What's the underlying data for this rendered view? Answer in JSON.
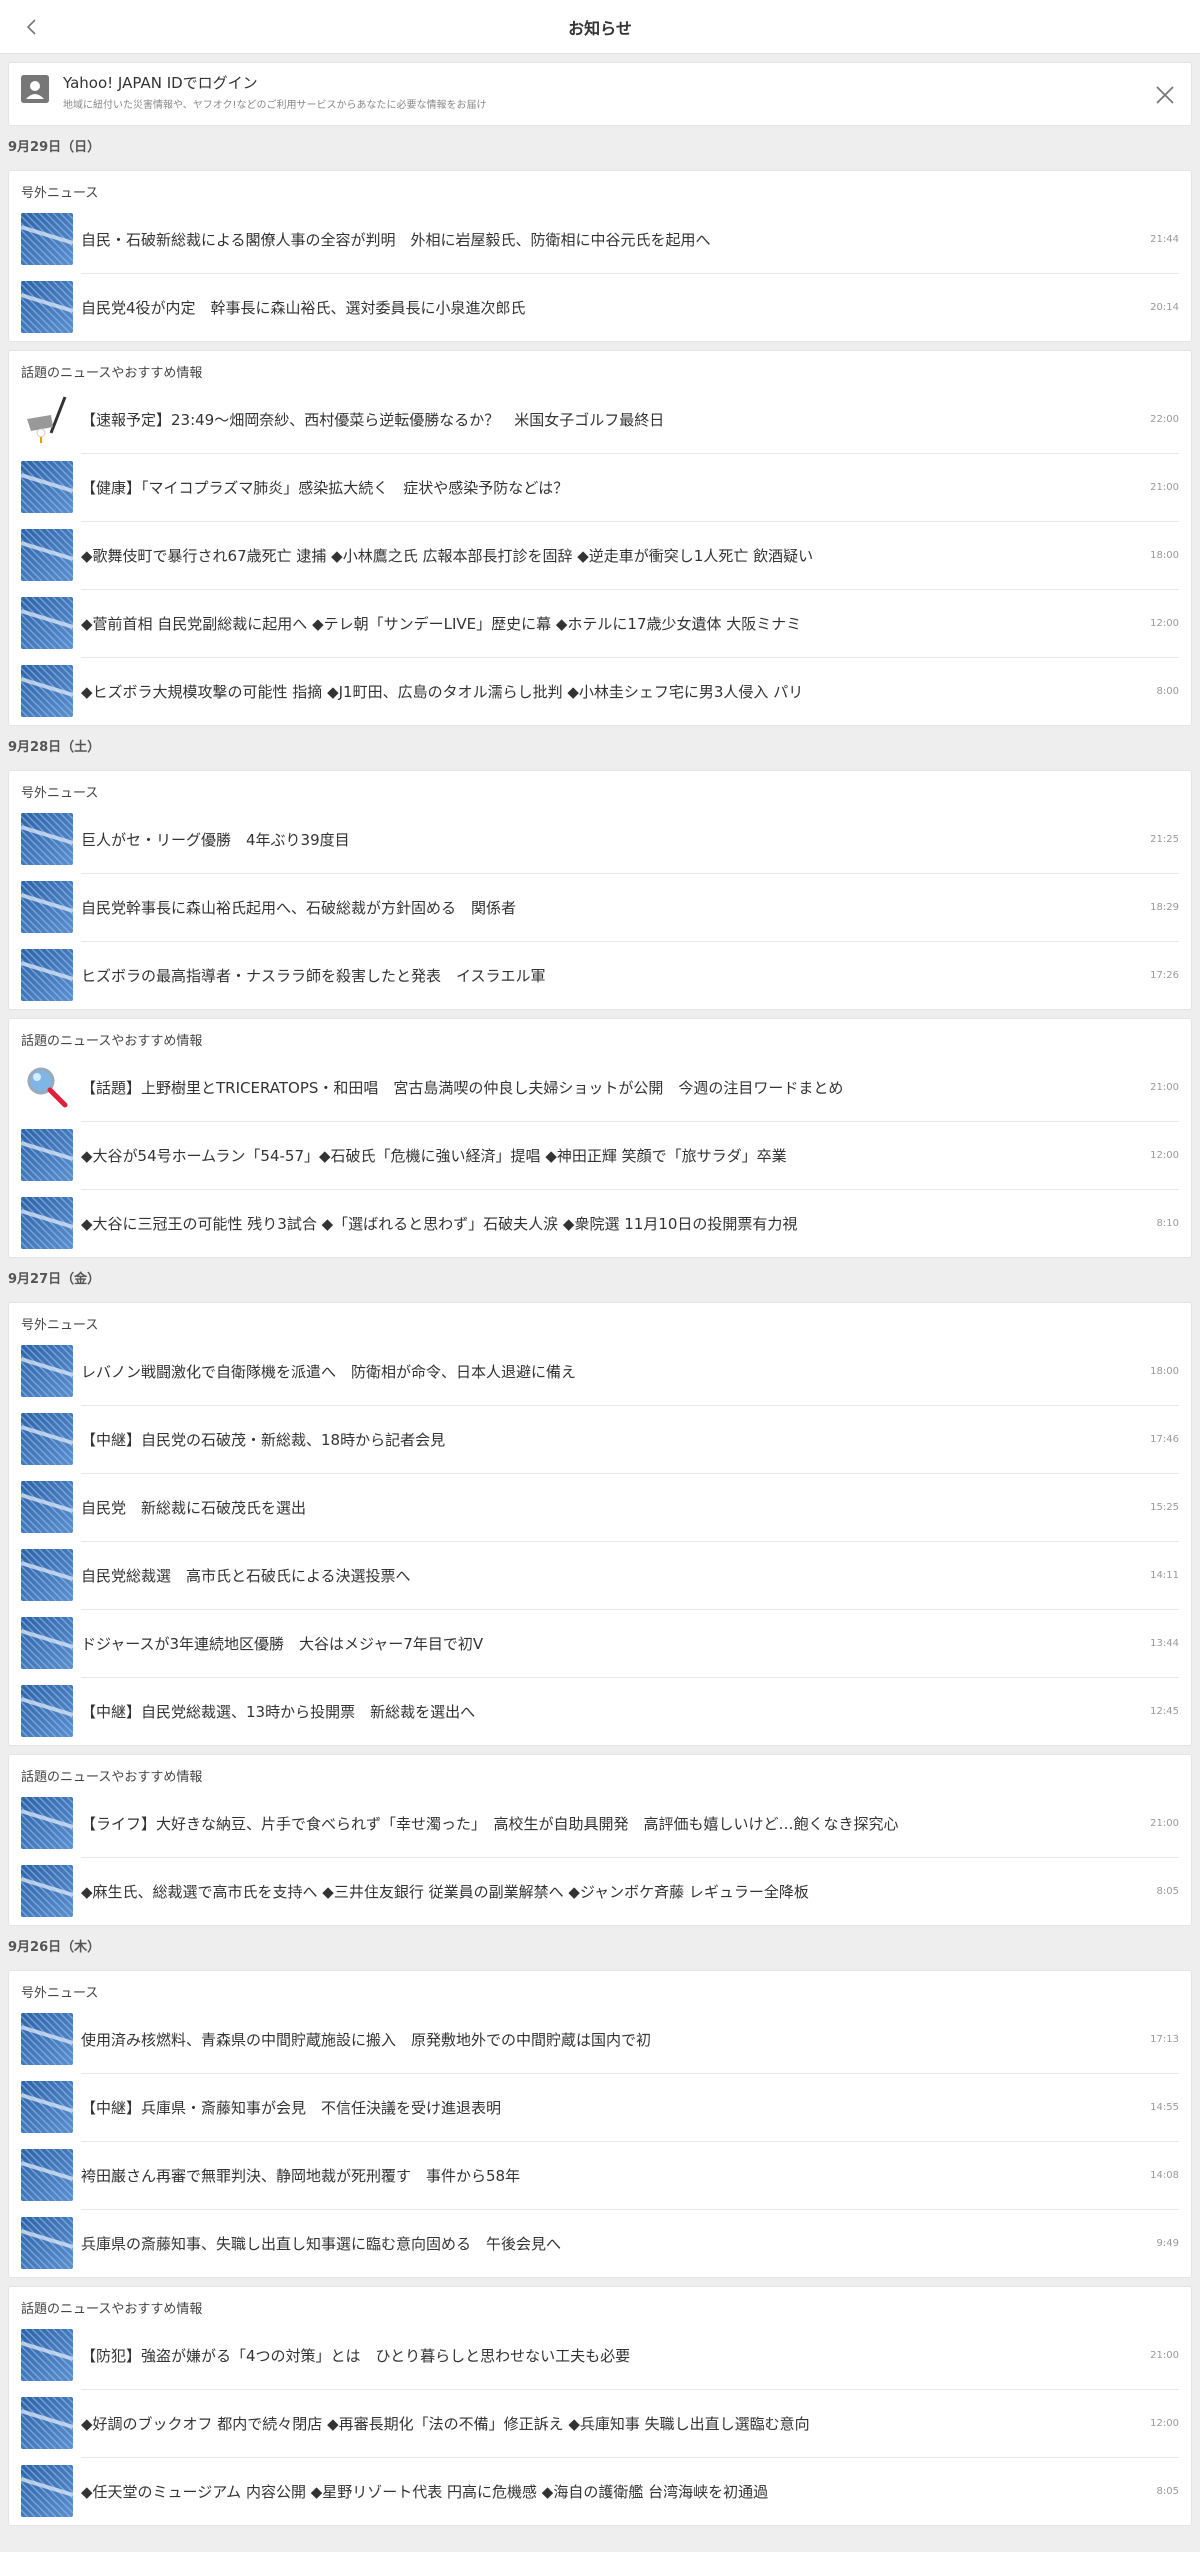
{
  "header": {
    "title": "お知らせ",
    "back_icon": "chevron-left-icon"
  },
  "login_banner": {
    "title": "Yahoo! JAPAN IDでログイン",
    "subtitle": "地域に紐付いた災害情報や、ヤフオク!などのご利用サービスからあなたに必要な情報をお届け",
    "avatar_icon": "user-icon",
    "close_icon": "close-icon"
  },
  "colors": {
    "thumb_blue": "#3a6fb0",
    "background": "#eeeeee",
    "card": "#ffffff"
  },
  "days": [
    {
      "date": "9月29日（日）",
      "sections": [
        {
          "label": "号外ニュース",
          "items": [
            {
              "title": "自民・石破新総裁による閣僚人事の全容が判明　外相に岩屋毅氏、防衛相に中谷元氏を起用へ",
              "time": "21:44",
              "thumb": "blue"
            },
            {
              "title": "自民党4役が内定　幹事長に森山裕氏、選対委員長に小泉進次郎氏",
              "time": "20:14",
              "thumb": "blue"
            }
          ]
        },
        {
          "label": "話題のニュースやおすすめ情報",
          "items": [
            {
              "title": "【速報予定】23:49～畑岡奈紗、西村優菜ら逆転優勝なるか？　米国女子ゴルフ最終日",
              "time": "22:00",
              "thumb": "golf"
            },
            {
              "title": "【健康】「マイコプラズマ肺炎」感染拡大続く　症状や感染予防などは？",
              "time": "21:00",
              "thumb": "blue"
            },
            {
              "title": "◆歌舞伎町で暴行され67歳死亡 逮捕 ◆小林鷹之氏 広報本部長打診を固辞 ◆逆走車が衝突し1人死亡 飲酒疑い",
              "time": "18:00",
              "thumb": "blue"
            },
            {
              "title": "◆菅前首相 自民党副総裁に起用へ ◆テレ朝「サンデーLIVE」歴史に幕 ◆ホテルに17歳少女遺体 大阪ミナミ",
              "time": "12:00",
              "thumb": "blue"
            },
            {
              "title": "◆ヒズボラ大規模攻撃の可能性 指摘 ◆J1町田、広島のタオル濡らし批判 ◆小林圭シェフ宅に男3人侵入 パリ",
              "time": "8:00",
              "thumb": "blue"
            }
          ]
        }
      ]
    },
    {
      "date": "9月28日（土）",
      "sections": [
        {
          "label": "号外ニュース",
          "items": [
            {
              "title": "巨人がセ・リーグ優勝　4年ぶり39度目",
              "time": "21:25",
              "thumb": "blue"
            },
            {
              "title": "自民党幹事長に森山裕氏起用へ、石破総裁が方針固める　関係者",
              "time": "18:29",
              "thumb": "blue"
            },
            {
              "title": "ヒズボラの最高指導者・ナスララ師を殺害したと発表　イスラエル軍",
              "time": "17:26",
              "thumb": "blue"
            }
          ]
        },
        {
          "label": "話題のニュースやおすすめ情報",
          "items": [
            {
              "title": "【話題】上野樹里とTRICERATOPS・和田唱　宮古島満喫の仲良し夫婦ショットが公開　今週の注目ワードまとめ",
              "time": "21:00",
              "thumb": "search"
            },
            {
              "title": "◆大谷が54号ホームラン「54-57」◆石破氏「危機に強い経済」提唱 ◆神田正輝 笑顔で「旅サラダ」卒業",
              "time": "12:00",
              "thumb": "blue"
            },
            {
              "title": "◆大谷に三冠王の可能性 残り3試合 ◆「選ばれると思わず」石破夫人涙 ◆衆院選 11月10日の投開票有力視",
              "time": "8:10",
              "thumb": "blue"
            }
          ]
        }
      ]
    },
    {
      "date": "9月27日（金）",
      "sections": [
        {
          "label": "号外ニュース",
          "items": [
            {
              "title": "レバノン戦闘激化で自衛隊機を派遣へ　防衛相が命令、日本人退避に備え",
              "time": "18:00",
              "thumb": "blue"
            },
            {
              "title": "【中継】自民党の石破茂・新総裁、18時から記者会見",
              "time": "17:46",
              "thumb": "blue"
            },
            {
              "title": "自民党　新総裁に石破茂氏を選出",
              "time": "15:25",
              "thumb": "blue"
            },
            {
              "title": "自民党総裁選　高市氏と石破氏による決選投票へ",
              "time": "14:11",
              "thumb": "blue"
            },
            {
              "title": "ドジャースが3年連続地区優勝　大谷はメジャー7年目で初V",
              "time": "13:44",
              "thumb": "blue"
            },
            {
              "title": "【中継】自民党総裁選、13時から投開票　新総裁を選出へ",
              "time": "12:45",
              "thumb": "blue"
            }
          ]
        },
        {
          "label": "話題のニュースやおすすめ情報",
          "items": [
            {
              "title": "【ライフ】大好きな納豆、片手で食べられず「幸せ濁った」　高校生が自助具開発　高評価も嬉しいけど…飽くなき探究心",
              "time": "21:00",
              "thumb": "blue"
            },
            {
              "title": "◆麻生氏、総裁選で高市氏を支持へ ◆三井住友銀行 従業員の副業解禁へ ◆ジャンボケ斉藤 レギュラー全降板",
              "time": "8:05",
              "thumb": "blue"
            }
          ]
        }
      ]
    },
    {
      "date": "9月26日（木）",
      "sections": [
        {
          "label": "号外ニュース",
          "items": [
            {
              "title": "使用済み核燃料、青森県の中間貯蔵施設に搬入　原発敷地外での中間貯蔵は国内で初",
              "time": "17:13",
              "thumb": "blue"
            },
            {
              "title": "【中継】兵庫県・斎藤知事が会見　不信任決議を受け進退表明",
              "time": "14:55",
              "thumb": "blue"
            },
            {
              "title": "袴田巌さん再審で無罪判決、静岡地裁が死刑覆す　事件から58年",
              "time": "14:08",
              "thumb": "blue"
            },
            {
              "title": "兵庫県の斎藤知事、失職し出直し知事選に臨む意向固める　午後会見へ",
              "time": "9:49",
              "thumb": "blue"
            }
          ]
        },
        {
          "label": "話題のニュースやおすすめ情報",
          "items": [
            {
              "title": "【防犯】強盗が嫌がる「4つの対策」とは　ひとり暮らしと思わせない工夫も必要",
              "time": "21:00",
              "thumb": "blue"
            },
            {
              "title": "◆好調のブックオフ 都内で続々閉店 ◆再審長期化「法の不備」修正訴え ◆兵庫知事 失職し出直し選臨む意向",
              "time": "12:00",
              "thumb": "blue"
            },
            {
              "title": "◆任天堂のミュージアム 内容公開 ◆星野リゾート代表 円高に危機感 ◆海自の護衛艦 台湾海峡を初通過",
              "time": "8:05",
              "thumb": "blue"
            }
          ]
        }
      ]
    }
  ]
}
